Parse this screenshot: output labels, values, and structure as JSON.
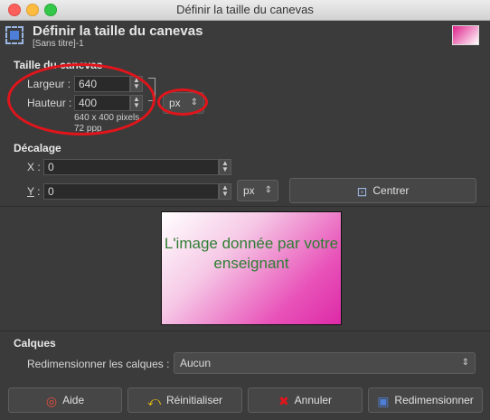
{
  "window": {
    "title": "Définir la taille du canevas"
  },
  "header": {
    "title": "Définir la taille du canevas",
    "subtitle": "[Sans titre]-1"
  },
  "canvas_size": {
    "section": "Taille du canevas",
    "width_label": "Largeur :",
    "width_value": "640",
    "height_label": "Hauteur :",
    "height_value": "400",
    "unit": "px",
    "info_line1": "640 x 400 pixels",
    "info_line2": "72 ppp"
  },
  "offset": {
    "section": "Décalage",
    "x_label": "X :",
    "x_value": "0",
    "y_label": "Y :",
    "y_value": "0",
    "unit": "px",
    "center_button": "Centrer"
  },
  "preview": {
    "text": "L'image donnée par votre enseignant"
  },
  "layers": {
    "section": "Calques",
    "resize_label": "Redimensionner les calques :",
    "resize_value": "Aucun"
  },
  "buttons": {
    "help": "Aide",
    "reset": "Réinitialiser",
    "cancel": "Annuler",
    "resize": "Redimensionner"
  },
  "colors": {
    "annotation": "#e0151b",
    "preview_text": "#2e7d32",
    "accent": "#4d7fd8"
  }
}
